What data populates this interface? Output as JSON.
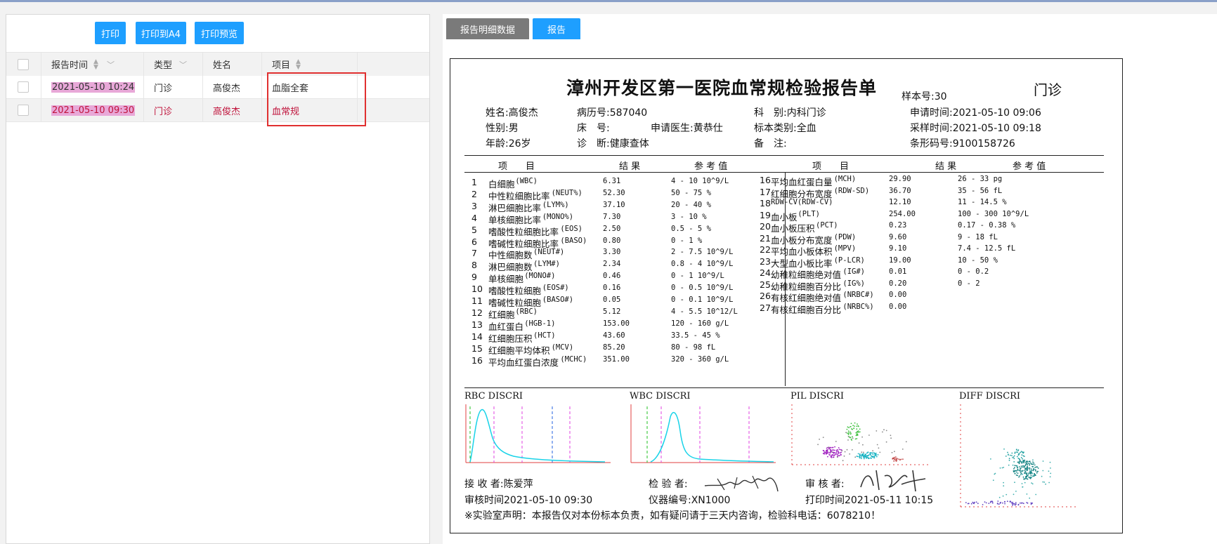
{
  "toolbar": {
    "print_label": "打印",
    "print_a4_label": "打印到A4",
    "print_preview_label": "打印预览"
  },
  "table": {
    "columns": [
      "报告时间",
      "类型",
      "姓名",
      "项目"
    ],
    "rows": [
      {
        "time": "2021-05-10 10:24",
        "type": "门诊",
        "name": "高俊杰",
        "item": "血脂全套"
      },
      {
        "time": "2021-05-10 09:30",
        "type": "门诊",
        "name": "高俊杰",
        "item": "血常规"
      }
    ]
  },
  "tabs": {
    "detail_label": "报告明细数据",
    "report_label": "报告"
  },
  "report": {
    "title": "漳州开发区第一医院血常规检验报告单",
    "sample_no": "样本号:30",
    "visit_type": "门诊",
    "info": {
      "name": "姓名:高俊杰",
      "record_no": "病历号:587040",
      "dept": "科　别:内科门诊",
      "apply_time": "申请时间:2021-05-10 09:06",
      "sex": "性别:男",
      "bed": "床　号:",
      "doctor": "申请医生:黄恭仕",
      "sample_type": "标本类别:全血",
      "collect_time": "采样时间:2021-05-10 09:18",
      "age": "年龄:26岁",
      "diagnosis": "诊　断:健康查体",
      "remark": "备　注:",
      "barcode": "条形码号:9100158726"
    },
    "headers": {
      "item": "项　　目",
      "result": "结 果",
      "ref": "参 考 值"
    },
    "left_rows": [
      {
        "no": "1",
        "name": "白细胞",
        "code": "(WBC)",
        "result": "6.31",
        "ref": "4 - 10 10^9/L"
      },
      {
        "no": "2",
        "name": "中性粒细胞比率",
        "code": "(NEUT%)",
        "result": "52.30",
        "ref": "50 - 75 %"
      },
      {
        "no": "3",
        "name": "淋巴细胞比率",
        "code": "(LYM%)",
        "result": "37.10",
        "ref": "20 - 40 %"
      },
      {
        "no": "4",
        "name": "单核细胞比率",
        "code": "(MONO%)",
        "result": "7.30",
        "ref": "3 - 10 %"
      },
      {
        "no": "5",
        "name": "嗜酸性粒细胞比率",
        "code": "(EOS)",
        "result": "2.50",
        "ref": "0.5 - 5 %"
      },
      {
        "no": "6",
        "name": "嗜碱性粒细胞比率",
        "code": "(BASO)",
        "result": "0.80",
        "ref": "0 - 1 %"
      },
      {
        "no": "7",
        "name": "中性细胞数",
        "code": "(NEUT#)",
        "result": "3.30",
        "ref": "2 - 7.5 10^9/L"
      },
      {
        "no": "8",
        "name": "淋巴细胞数",
        "code": "(LYM#)",
        "result": "2.34",
        "ref": "0.8 - 4 10^9/L"
      },
      {
        "no": "9",
        "name": "单核细胞",
        "code": "(MONO#)",
        "result": "0.46",
        "ref": "0 - 1 10^9/L"
      },
      {
        "no": "10",
        "name": "嗜酸性粒细胞",
        "code": "(EOS#)",
        "result": "0.16",
        "ref": "0 - 0.5 10^9/L"
      },
      {
        "no": "11",
        "name": "嗜碱性粒细胞",
        "code": "(BASO#)",
        "result": "0.05",
        "ref": "0 - 0.1 10^9/L"
      },
      {
        "no": "12",
        "name": "红细胞",
        "code": "(RBC)",
        "result": "5.12",
        "ref": "4 - 5.5 10^12/L"
      },
      {
        "no": "13",
        "name": "血红蛋白",
        "code": "(HGB-1)",
        "result": "153.00",
        "ref": "120 - 160 g/L"
      },
      {
        "no": "14",
        "name": "红细胞压积",
        "code": "(HCT)",
        "result": "43.60",
        "ref": "33.5 - 45 %"
      },
      {
        "no": "15",
        "name": "红细胞平均体积",
        "code": "(MCV)",
        "result": "85.20",
        "ref": "80 - 98 fL"
      },
      {
        "no": "16",
        "name": "平均血红蛋白浓度",
        "code": "(MCHC)",
        "result": "351.00",
        "ref": "320 - 360 g/L"
      }
    ],
    "right_rows": [
      {
        "no": "16",
        "name": "平均血红蛋白量",
        "code": "(MCH)",
        "result": "29.90",
        "ref": "26 - 33 pg"
      },
      {
        "no": "17",
        "name": "红细胞分布宽度",
        "code": "(RDW-SD)",
        "result": "36.70",
        "ref": "35 - 56 fL"
      },
      {
        "no": "18",
        "name": "",
        "code": "RDW-CV(RDW-CV)",
        "result": "12.10",
        "ref": "11 - 14.5 %"
      },
      {
        "no": "19",
        "name": "血小板",
        "code": "(PLT)",
        "result": "254.00",
        "ref": "100 - 300 10^9/L"
      },
      {
        "no": "20",
        "name": "血小板压积",
        "code": "(PCT)",
        "result": "0.23",
        "ref": "0.17 - 0.38 %"
      },
      {
        "no": "21",
        "name": "血小板分布宽度",
        "code": "(PDW)",
        "result": "9.60",
        "ref": "9 - 18 fL"
      },
      {
        "no": "22",
        "name": "平均血小板体积",
        "code": "(MPV)",
        "result": "9.10",
        "ref": "7.4 - 12.5 fL"
      },
      {
        "no": "23",
        "name": "大型血小板比率",
        "code": "(P-LCR)",
        "result": "19.00",
        "ref": "10 - 50 %"
      },
      {
        "no": "24",
        "name": "幼稚粒细胞绝对值",
        "code": "(IG#)",
        "result": "0.01",
        "ref": "0 - 0.2"
      },
      {
        "no": "25",
        "name": "幼稚粒细胞百分比",
        "code": "(IG%)",
        "result": "0.20",
        "ref": "0 - 2"
      },
      {
        "no": "26",
        "name": "有核红细胞绝对值",
        "code": "(NRBC#)",
        "result": "0.00",
        "ref": ""
      },
      {
        "no": "27",
        "name": "有核红细胞百分比",
        "code": "(NRBC%)",
        "result": "0.00",
        "ref": ""
      }
    ],
    "charts": {
      "rbc": "RBC  DISCRI",
      "wbc": "WBC  DISCRI",
      "pil": "PIL  DISCRI",
      "diff": "DIFF  DISCRI"
    },
    "footer": {
      "receiver": "接 收 者:陈爱萍",
      "tester": "检 验 者:",
      "reviewer": "审 核 者:",
      "review_time": "审核时间2021-05-10 09:30",
      "instrument": "仪器编号:XN1000",
      "print_time": "打印时间2021-05-11 10:15",
      "statement": "※实验室声明：本报告仅对本份标本负责，如有疑问请于三天内咨询，检验科电话：6078210！"
    },
    "colors": {
      "curve": "#19d3e8",
      "pink_dash": "#e040e0",
      "green_dash": "#20c020",
      "axis_red": "#e04040"
    }
  }
}
